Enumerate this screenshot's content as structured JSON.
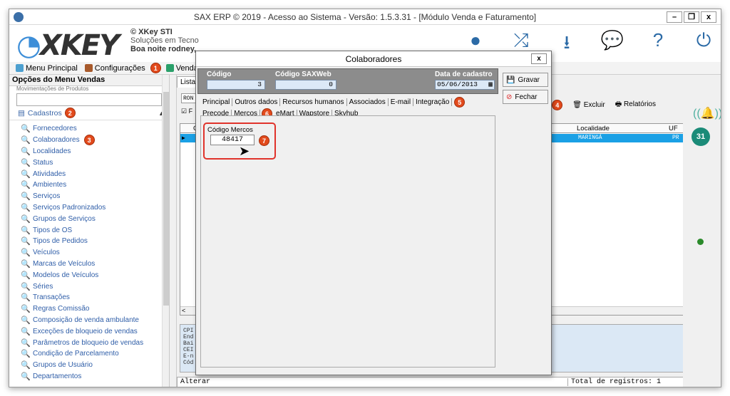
{
  "window": {
    "title": "SAX ERP © 2019 - Acesso ao Sistema - Versão: 1.5.3.31 - [Módulo Venda e Faturamento]",
    "controls": [
      "–",
      "❐",
      "x"
    ]
  },
  "header": {
    "logo_text": "XKEY",
    "company_name": "© XKey STI",
    "company_slogan": "Soluções em Tecno",
    "greeting": "Boa noite rodney,"
  },
  "menubar": {
    "items": [
      {
        "label": "Menu Principal"
      },
      {
        "label": "Configurações"
      },
      {
        "label": "Vendas"
      }
    ]
  },
  "badges": [
    "1",
    "2",
    "3",
    "4",
    "5",
    "6",
    "7"
  ],
  "sidebar": {
    "title": "Opções do Menu Vendas",
    "pin": "‡",
    "clipped_item": "Movimentações de Produtos",
    "section": "Cadastros",
    "section_toggle": "▲",
    "items": [
      "Fornecedores",
      "Colaboradores",
      "Localidades",
      "Status",
      "Atividades",
      "Ambientes",
      "Serviços",
      "Serviços Padronizados",
      "Grupos de Serviços",
      "Tipos de OS",
      "Tipos de Pedidos",
      "Veículos",
      "Marcas de Veículos",
      "Modelos de Veículos",
      "Séries",
      "Transações",
      "Regras Comissão",
      "Composição de venda ambulante",
      "Exceções de bloqueio de vendas",
      "Parâmetros de bloqueio de vendas",
      "Condição de Parcelamento",
      "Grupos de Usuário",
      "Departamentos"
    ]
  },
  "main": {
    "tab_label": "Lista",
    "search_value": "RON",
    "toolbar": {
      "excluir": "Excluir",
      "relatorios": "Relatórios",
      "alterar_clip": "rar"
    },
    "grid": {
      "col_check": "Có",
      "columns": [
        "Localidade",
        "UF",
        "C"
      ],
      "row": {
        "localidade": "MARINGÁ",
        "uf": "PR"
      }
    },
    "details_labels": [
      "CPI",
      "End",
      "Bai",
      "CEI",
      "E-n",
      "Cód"
    ],
    "status_left": "Alterar",
    "status_right": "Total de registros: 1",
    "scroll_left": "<",
    "scroll_right": ">"
  },
  "dialog": {
    "title": "Colaboradores",
    "close": "x",
    "fields": {
      "codigo_label": "Código",
      "codigo_value": "3",
      "codigo_saxweb_label": "Código SAXWeb",
      "codigo_saxweb_value": "0",
      "data_label": "Data de cadastro",
      "data_value": "05/06/2013"
    },
    "buttons": {
      "gravar": "Gravar",
      "fechar": "Fechar"
    },
    "tabs": [
      "Principal",
      "Outros dados",
      "Recursos humanos",
      "Associados",
      "E-mail",
      "Integração"
    ],
    "subtabs": [
      "Precode",
      "Mercos",
      "eMart",
      "Wapstore",
      "Skyhub"
    ],
    "mercos_label": "Código Mercos",
    "mercos_value": "48417"
  },
  "right_strip": {
    "calendar_day": "31"
  },
  "colors": {
    "accent": "#1aa0e5",
    "badge": "#e24a1c",
    "link": "#2f5ea8",
    "highlight_border": "#e0332b"
  }
}
